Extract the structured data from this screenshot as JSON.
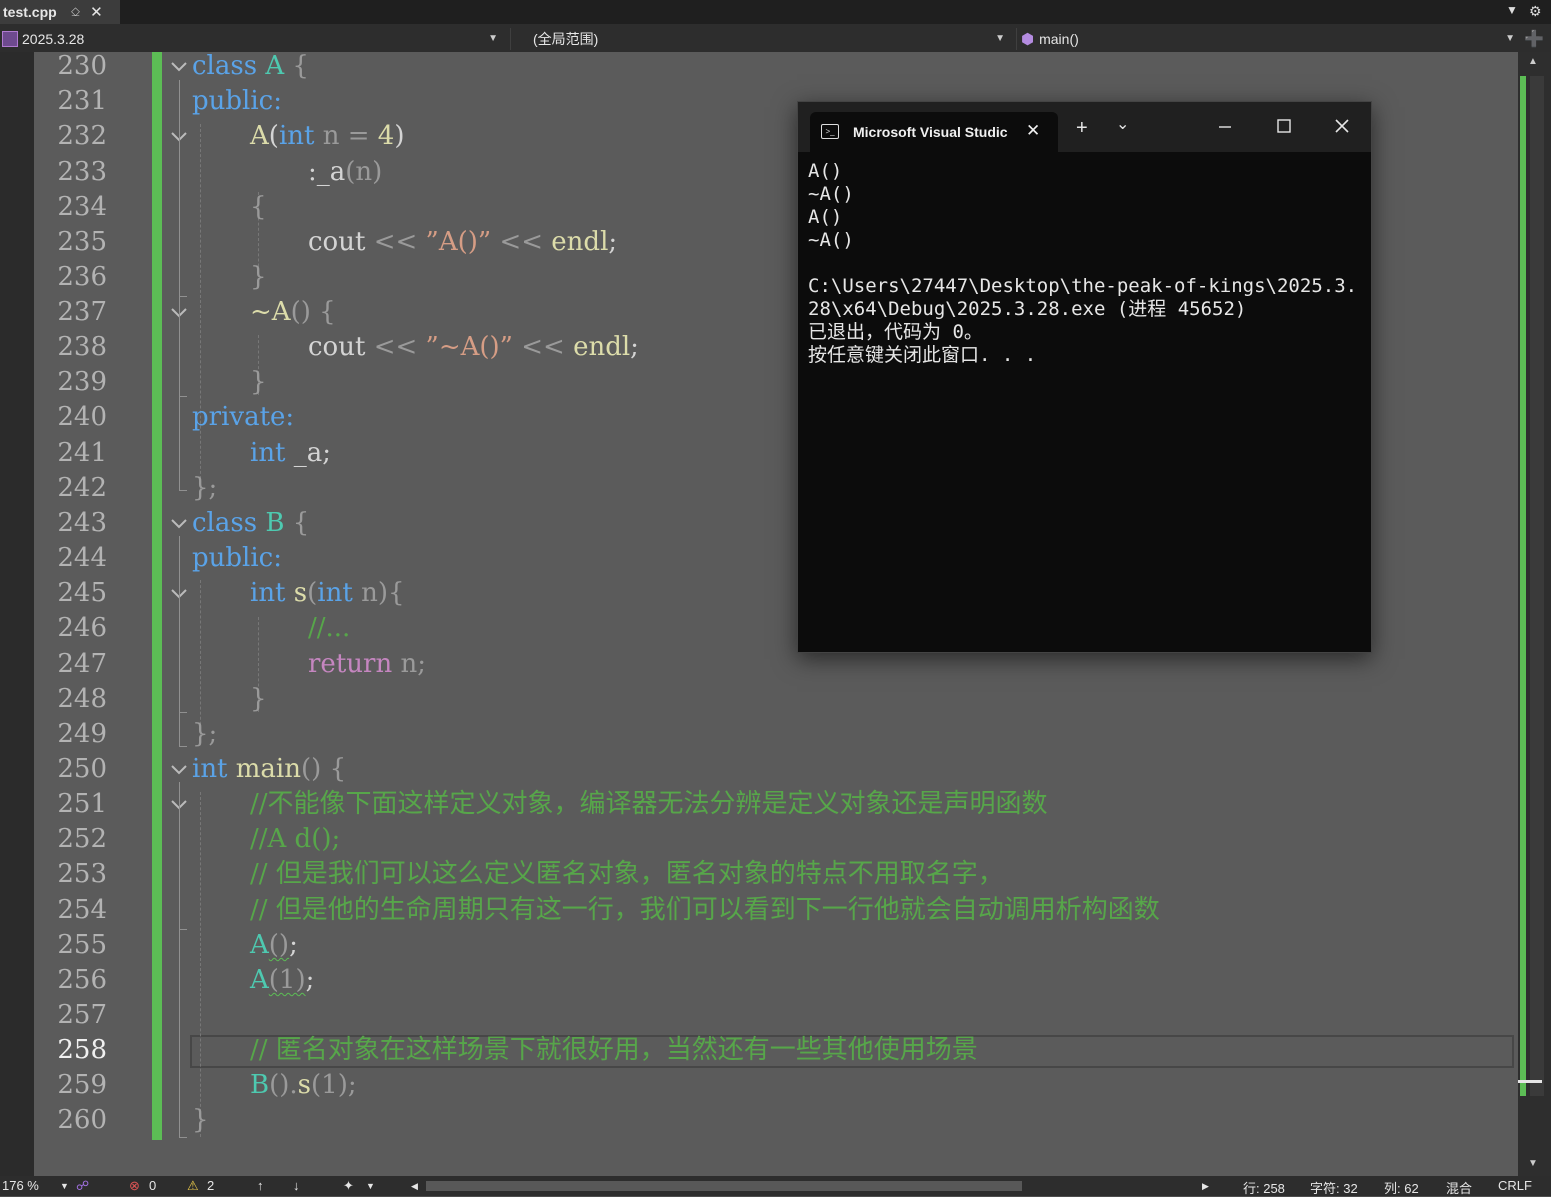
{
  "tab": {
    "filename": "test.cpp",
    "pin": "⎐",
    "close": "✕"
  },
  "navbar": {
    "project": "2025.3.28",
    "scope": "(全局范围)",
    "member": "main()"
  },
  "editor": {
    "line_numbers": [
      "230",
      "231",
      "232",
      "233",
      "234",
      "235",
      "236",
      "237",
      "238",
      "239",
      "240",
      "241",
      "242",
      "243",
      "244",
      "245",
      "246",
      "247",
      "248",
      "249",
      "250",
      "251",
      "252",
      "253",
      "254",
      "255",
      "256",
      "257",
      "258",
      "259",
      "260"
    ],
    "current_line": "258",
    "code": {
      "l230_kw": "class",
      "l230_name": "A",
      "l230_brace": "{",
      "l231": "public:",
      "l232_name": "A",
      "l232_p1": "(",
      "l232_kw": "int",
      "l232_param": "n",
      "l232_eq": "=",
      "l232_val": "4",
      "l232_p2": ")",
      "l233_colon": ":",
      "l233_mem": "_a",
      "l233_arg": "(n)",
      "l234": "{",
      "l235_cout": "cout",
      "l235_op1": "<<",
      "l235_str": "”A()”",
      "l235_op2": "<<",
      "l235_endl": "endl",
      "l235_semi": ";",
      "l236": "}",
      "l237_tilde": "~",
      "l237_name": "A",
      "l237_parens": "()",
      "l237_brace": "{",
      "l238_cout": "cout",
      "l238_op1": "<<",
      "l238_str": "”~A()”",
      "l238_op2": "<<",
      "l238_endl": "endl",
      "l238_semi": ";",
      "l239": "}",
      "l240": "private:",
      "l241_kw": "int",
      "l241_mem": "_a;",
      "l242": "};",
      "l243_kw": "class",
      "l243_name": "B",
      "l243_brace": "{",
      "l244": "public:",
      "l245_kw": "int",
      "l245_fn": "s",
      "l245_p1": "(",
      "l245_kw2": "int",
      "l245_param": "n",
      "l245_p2": "){",
      "l246": "//...",
      "l247_kw": "return",
      "l247_val": "n;",
      "l248": "}",
      "l249": "};",
      "l250_kw": "int",
      "l250_fn": "main",
      "l250_parens": "()",
      "l250_brace": "{",
      "l251": "//不能像下面这样定义对象，编译器无法分辨是定义对象还是声明函数",
      "l252": "//A d();",
      "l253": "// 但是我们可以这么定义匿名对象，匿名对象的特点不用取名字，",
      "l254": "// 但是他的生命周期只有这一行，我们可以看到下一行他就会自动调用析构函数",
      "l255_name": "A",
      "l255_parens": "()",
      "l255_semi": ";",
      "l256_name": "A",
      "l256_args": "(1)",
      "l256_semi": ";",
      "l258": "// 匿名对象在这样场景下就很好用，当然还有一些其他使用场景",
      "l259_name": "B",
      "l259_rest": "().",
      "l259_fn": "s",
      "l259_args": "(1);",
      "l260": "}"
    }
  },
  "console": {
    "title": "Microsoft Visual Studic",
    "new_tab": "+",
    "dropdown": "⌄",
    "output": "A()\n~A()\nA()\n~A()\n\nC:\\Users\\27447\\Desktop\\the-peak-of-kings\\2025.3.28\\x64\\Debug\\2025.3.28.exe (进程 45652)\n已退出，代码为 0。\n按任意键关闭此窗口. . ."
  },
  "statusbar": {
    "zoom": "176 %",
    "errors": "0",
    "warnings": "2",
    "line": "行: 258",
    "char": "字符: 32",
    "col": "列: 62",
    "encoding": "混合",
    "eol": "CRLF"
  },
  "colors": {
    "change_bar": "#5cbd55",
    "keyword": "#5aa3e8",
    "type": "#4ec9b0",
    "comment": "#57a64a",
    "string": "#d69d85",
    "function": "#dcdcaa",
    "control": "#c586c0"
  }
}
